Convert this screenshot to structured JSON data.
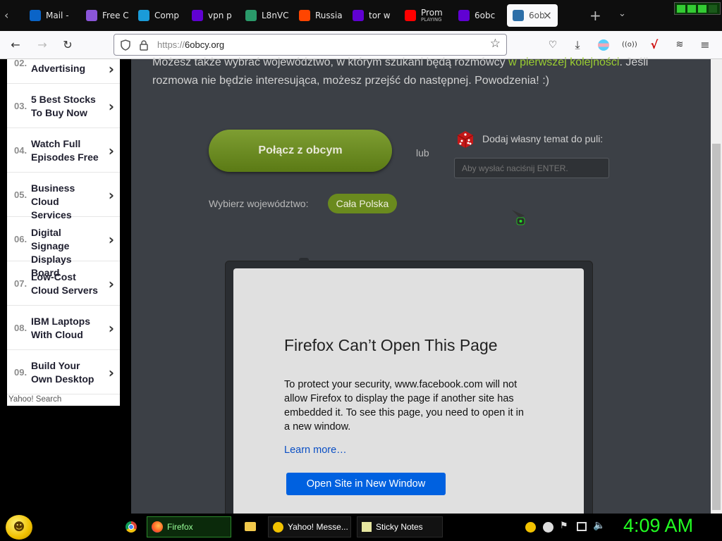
{
  "tabs": [
    {
      "label": "Mail -",
      "icon": "outlook-icon",
      "color": "#0a64c8"
    },
    {
      "label": "Free C",
      "icon": "c-app-icon",
      "color": "#8a55d8"
    },
    {
      "label": "Comp",
      "icon": "location-pin-icon",
      "color": "#1a9bd8"
    },
    {
      "label": "vpn p",
      "icon": "yahoo-icon",
      "color": "#6001d2"
    },
    {
      "label": "L8nVC",
      "icon": "maps-icon",
      "color": "#2a9a6a"
    },
    {
      "label": "Russia",
      "icon": "reddit-icon",
      "color": "#ff4500"
    },
    {
      "label": "tor w",
      "icon": "yahoo-icon",
      "color": "#6001d2"
    },
    {
      "label": "Prom",
      "sub": "PLAYING",
      "icon": "youtube-icon",
      "color": "#ff0000"
    },
    {
      "label": "6obc",
      "icon": "yahoo-icon",
      "color": "#6001d2"
    },
    {
      "label": "6ob",
      "icon": "6obcy-icon",
      "color": "#2d6fa8",
      "active": true
    }
  ],
  "url": {
    "scheme": "https://",
    "host": "6obcy.org"
  },
  "sidebar": {
    "items": [
      {
        "num": "02.",
        "lines": [
          "",
          "Advertising"
        ]
      },
      {
        "num": "03.",
        "lines": [
          "5 Best Stocks",
          "To Buy Now"
        ]
      },
      {
        "num": "04.",
        "lines": [
          "Watch Full",
          "Episodes Free"
        ]
      },
      {
        "num": "05.",
        "lines": [
          "Business",
          "Cloud Services"
        ]
      },
      {
        "num": "06.",
        "lines": [
          "Digital Signage",
          "Displays Board"
        ]
      },
      {
        "num": "07.",
        "lines": [
          "Low-Cost",
          "Cloud Servers"
        ]
      },
      {
        "num": "08.",
        "lines": [
          "IBM Laptops",
          "With Cloud"
        ]
      },
      {
        "num": "09.",
        "lines": [
          "Build Your",
          "Own Desktop"
        ]
      }
    ],
    "footer": "Yahoo! Search"
  },
  "main": {
    "intro_line1": "Możesz także wybrać województwo, w którym szukani będą rozmówcy ",
    "intro_highlight": "w pierwszej kolejności",
    "intro_line1_end": ". Jeśli",
    "intro_line2": "rozmowa nie będzie interesująca, możesz przejść do następnej. Powodzenia! :)",
    "connect_button": "Połącz z obcym",
    "or_text": "lub",
    "add_topic_label": "Dodaj własny temat do puli:",
    "topic_placeholder": "Aby wysłać naciśnij ENTER.",
    "region_label": "Wybierz województwo:",
    "region_value": "Cała Polska",
    "accent": "#6a8a1e",
    "highlight_color": "#9acd32"
  },
  "embed": {
    "title": "Firefox Can’t Open This Page",
    "body": "To protect your security, www.facebook.com will not allow Firefox to display the page if another site has embedded it. To see this page, you need to open it in a new window.",
    "learn_more": "Learn more…",
    "open_button": "Open Site in New Window"
  },
  "taskbar": {
    "firefox": "Firefox",
    "yahoo_messenger": "Yahoo! Messe...",
    "sticky_notes": "Sticky Notes",
    "clock": "4:09 AM",
    "clock_color": "#22ff22"
  }
}
